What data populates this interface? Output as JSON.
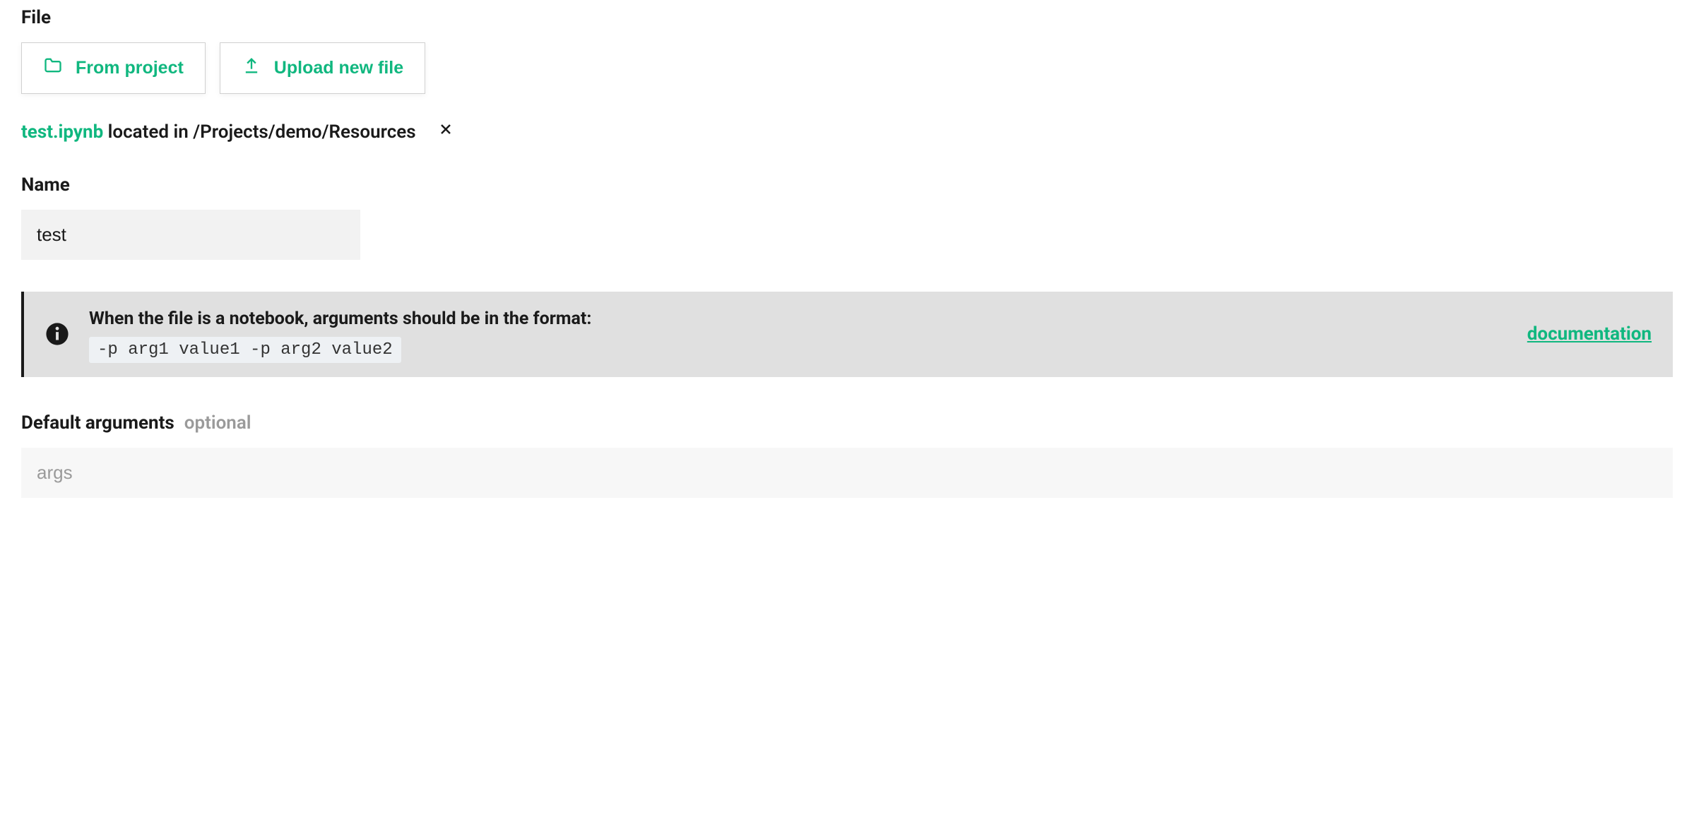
{
  "file": {
    "section_label": "File",
    "from_project_label": "From project",
    "upload_label": "Upload new file"
  },
  "selected_file": {
    "name": "test.ipynb",
    "location_prefix": " located in ",
    "path": "/Projects/demo/Resources"
  },
  "name_field": {
    "label": "Name",
    "value": "test"
  },
  "info": {
    "message": "When the file is a notebook, arguments should be in the format:",
    "code": "-p arg1 value1 -p arg2 value2",
    "doc_link_label": "documentation"
  },
  "default_args": {
    "label": "Default arguments",
    "optional_label": "optional",
    "placeholder": "args"
  }
}
